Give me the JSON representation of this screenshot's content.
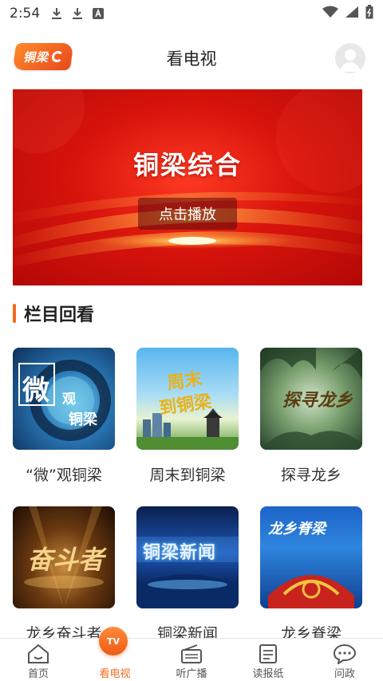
{
  "status_bar": {
    "time": "2:54"
  },
  "header": {
    "logo_text": "铜梁",
    "title": "看电视"
  },
  "banner": {
    "title": "铜梁综合",
    "play_label": "点击播放"
  },
  "section": {
    "title": "栏目回看"
  },
  "programs": [
    {
      "label": "“微”观铜梁",
      "thumb_text": "微观铜梁"
    },
    {
      "label": "周末到铜梁",
      "thumb_text": "周末到铜梁"
    },
    {
      "label": "探寻龙乡",
      "thumb_text": "探寻龙乡"
    },
    {
      "label": "龙乡奋斗者",
      "thumb_text": "奋斗者"
    },
    {
      "label": "铜梁新闻",
      "thumb_text": "铜梁新闻"
    },
    {
      "label": "龙乡脊梁",
      "thumb_text": "龙乡脊梁"
    }
  ],
  "tabbar": {
    "items": [
      {
        "label": "首页"
      },
      {
        "label": "看电视",
        "badge": "TV"
      },
      {
        "label": "听广播"
      },
      {
        "label": "读报纸"
      },
      {
        "label": "问政"
      }
    ]
  },
  "colors": {
    "accent": "#f26a1f",
    "banner_red": "#d8140c"
  }
}
